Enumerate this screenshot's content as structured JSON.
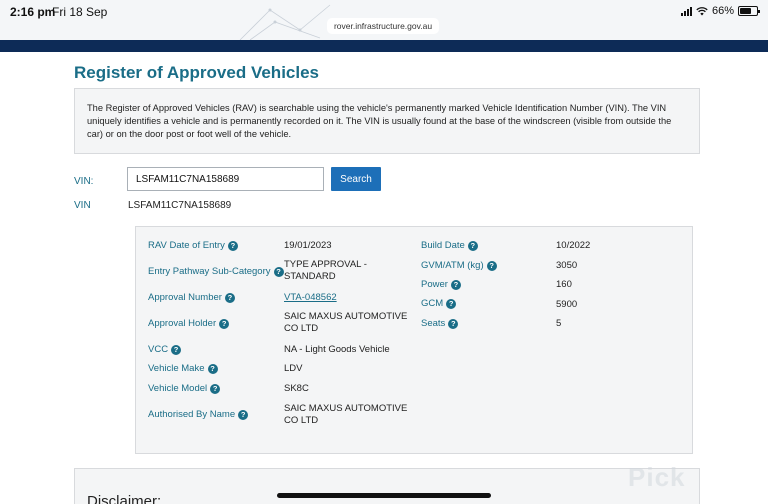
{
  "status_bar": {
    "time": "2:16 pm",
    "date": "Fri 18 Sep",
    "url": "rover.infrastructure.gov.au",
    "battery": "66%",
    "battery_level": 0.66
  },
  "page": {
    "title": "Register of Approved Vehicles",
    "info_text": "The Register of Approved Vehicles (RAV) is searchable using the vehicle's permanently marked Vehicle Identification Number (VIN). The VIN uniquely identifies a vehicle and is permanently recorded on it. The VIN is usually found at the base of the windscreen (visible from outside the car) or on the door post or foot well of the vehicle."
  },
  "search": {
    "label": "VIN:",
    "value": "LSFAM11C7NA158689",
    "button": "Search"
  },
  "result": {
    "vin_label": "VIN",
    "vin_value": "LSFAM11C7NA158689",
    "left": [
      {
        "label": "RAV Date of Entry",
        "value": "19/01/2023"
      },
      {
        "label": "Entry Pathway Sub-Category",
        "value": "TYPE APPROVAL - STANDARD"
      },
      {
        "label": "Approval Number",
        "value": "VTA-048562"
      },
      {
        "label": "Approval Holder",
        "value": "SAIC MAXUS AUTOMOTIVE CO LTD"
      },
      {
        "label": "VCC",
        "value": "NA - Light Goods Vehicle"
      },
      {
        "label": "Vehicle Make",
        "value": "LDV"
      },
      {
        "label": "Vehicle Model",
        "value": "SK8C"
      },
      {
        "label": "Authorised By Name",
        "value": "SAIC MAXUS AUTOMOTIVE CO LTD"
      }
    ],
    "right": [
      {
        "label": "Build Date",
        "value": "10/2022"
      },
      {
        "label": "GVM/ATM (kg)",
        "value": "3050"
      },
      {
        "label": "Power",
        "value": "160"
      },
      {
        "label": "GCM",
        "value": "5900"
      },
      {
        "label": "Seats",
        "value": "5"
      }
    ]
  },
  "disclaimer": {
    "heading": "Disclaimer:"
  },
  "watermark": "Pick",
  "icons": {
    "help": "help-circle-icon",
    "wifi": "wifi-icon",
    "signal": "signal-icon",
    "battery": "battery-icon"
  }
}
